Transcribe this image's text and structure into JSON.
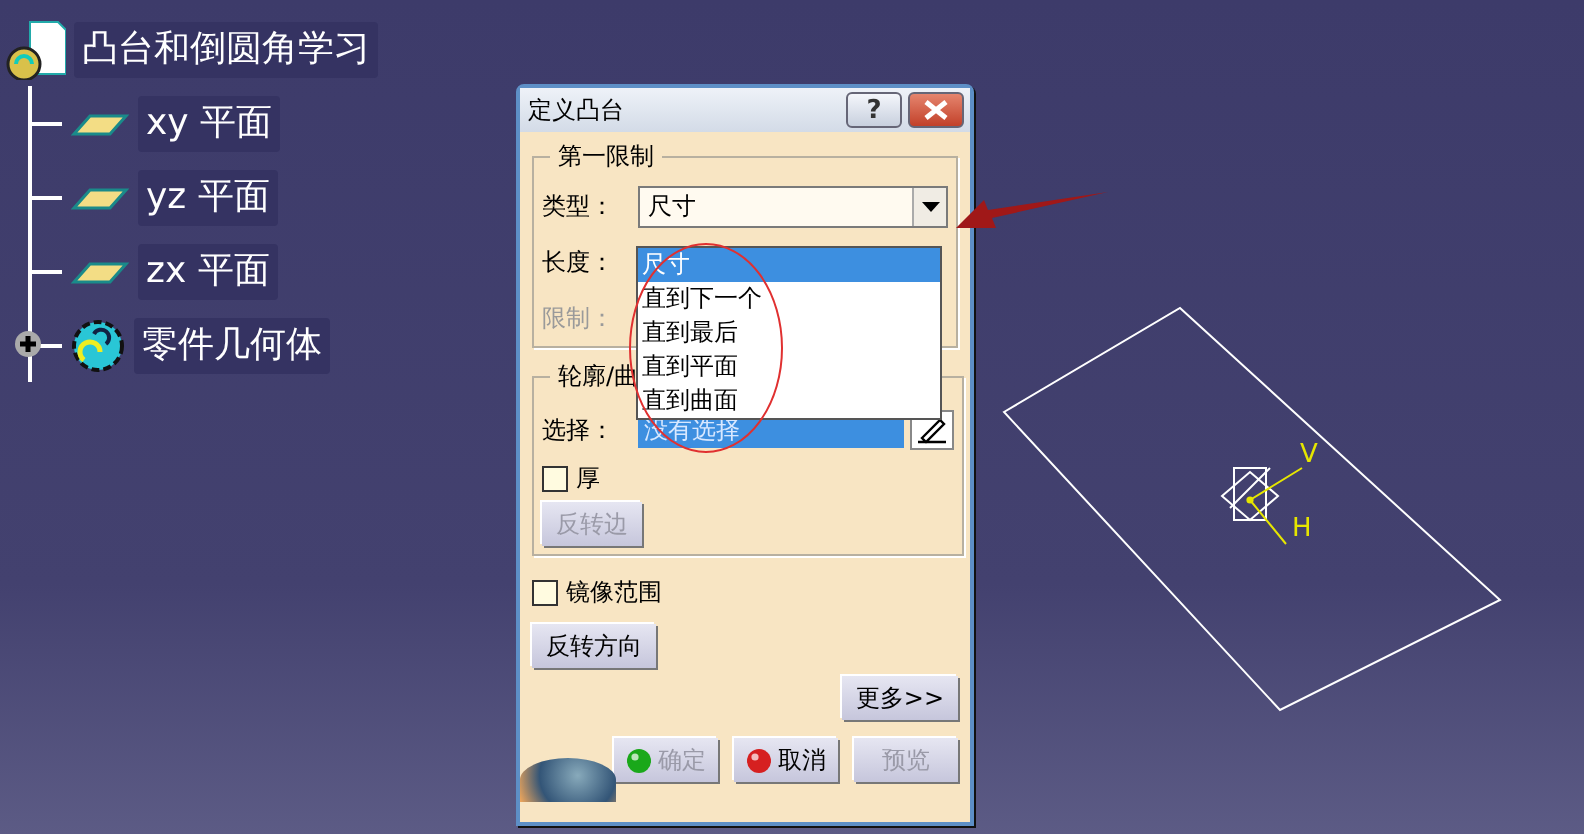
{
  "tree": {
    "label": "凸台和倒圆角学习",
    "children": [
      {
        "label": "xy 平面",
        "kind": "plane"
      },
      {
        "label": "yz 平面",
        "kind": "plane"
      },
      {
        "label": "zx 平面",
        "kind": "plane"
      },
      {
        "label": "零件几何体",
        "kind": "body",
        "expanded": false
      }
    ]
  },
  "dialog": {
    "title": "定义凸台",
    "help_button": "?",
    "first_limit": {
      "title": "第一限制",
      "type_label": "类型：",
      "type_value": "尺寸",
      "length_label": "长度：",
      "limit_label": "限制：",
      "limit_disabled": true
    },
    "dropdown": {
      "options": [
        {
          "label": "尺寸",
          "selected": true
        },
        {
          "label": "直到下一个",
          "selected": false
        },
        {
          "label": "直到最后",
          "selected": false
        },
        {
          "label": "直到平面",
          "selected": false
        },
        {
          "label": "直到曲面",
          "selected": false
        }
      ]
    },
    "profile": {
      "title": "轮廓/曲",
      "select_label": "选择：",
      "select_value": "没有选择",
      "thick": {
        "label": "厚",
        "checked": false
      },
      "reverse_side": {
        "label": "反转边",
        "disabled": true
      }
    },
    "mirror": {
      "label": "镜像范围",
      "checked": false
    },
    "reverse_direction": {
      "label": "反转方向",
      "disabled": false
    },
    "more_button": "更多>>",
    "buttons": [
      {
        "label": "确定",
        "kind": "ok",
        "disabled": true
      },
      {
        "label": "取消",
        "kind": "cancel",
        "disabled": false
      },
      {
        "label": "预览",
        "kind": "preview",
        "disabled": true
      }
    ]
  },
  "viewport": {
    "axis_labels": [
      "V",
      "H"
    ]
  }
}
